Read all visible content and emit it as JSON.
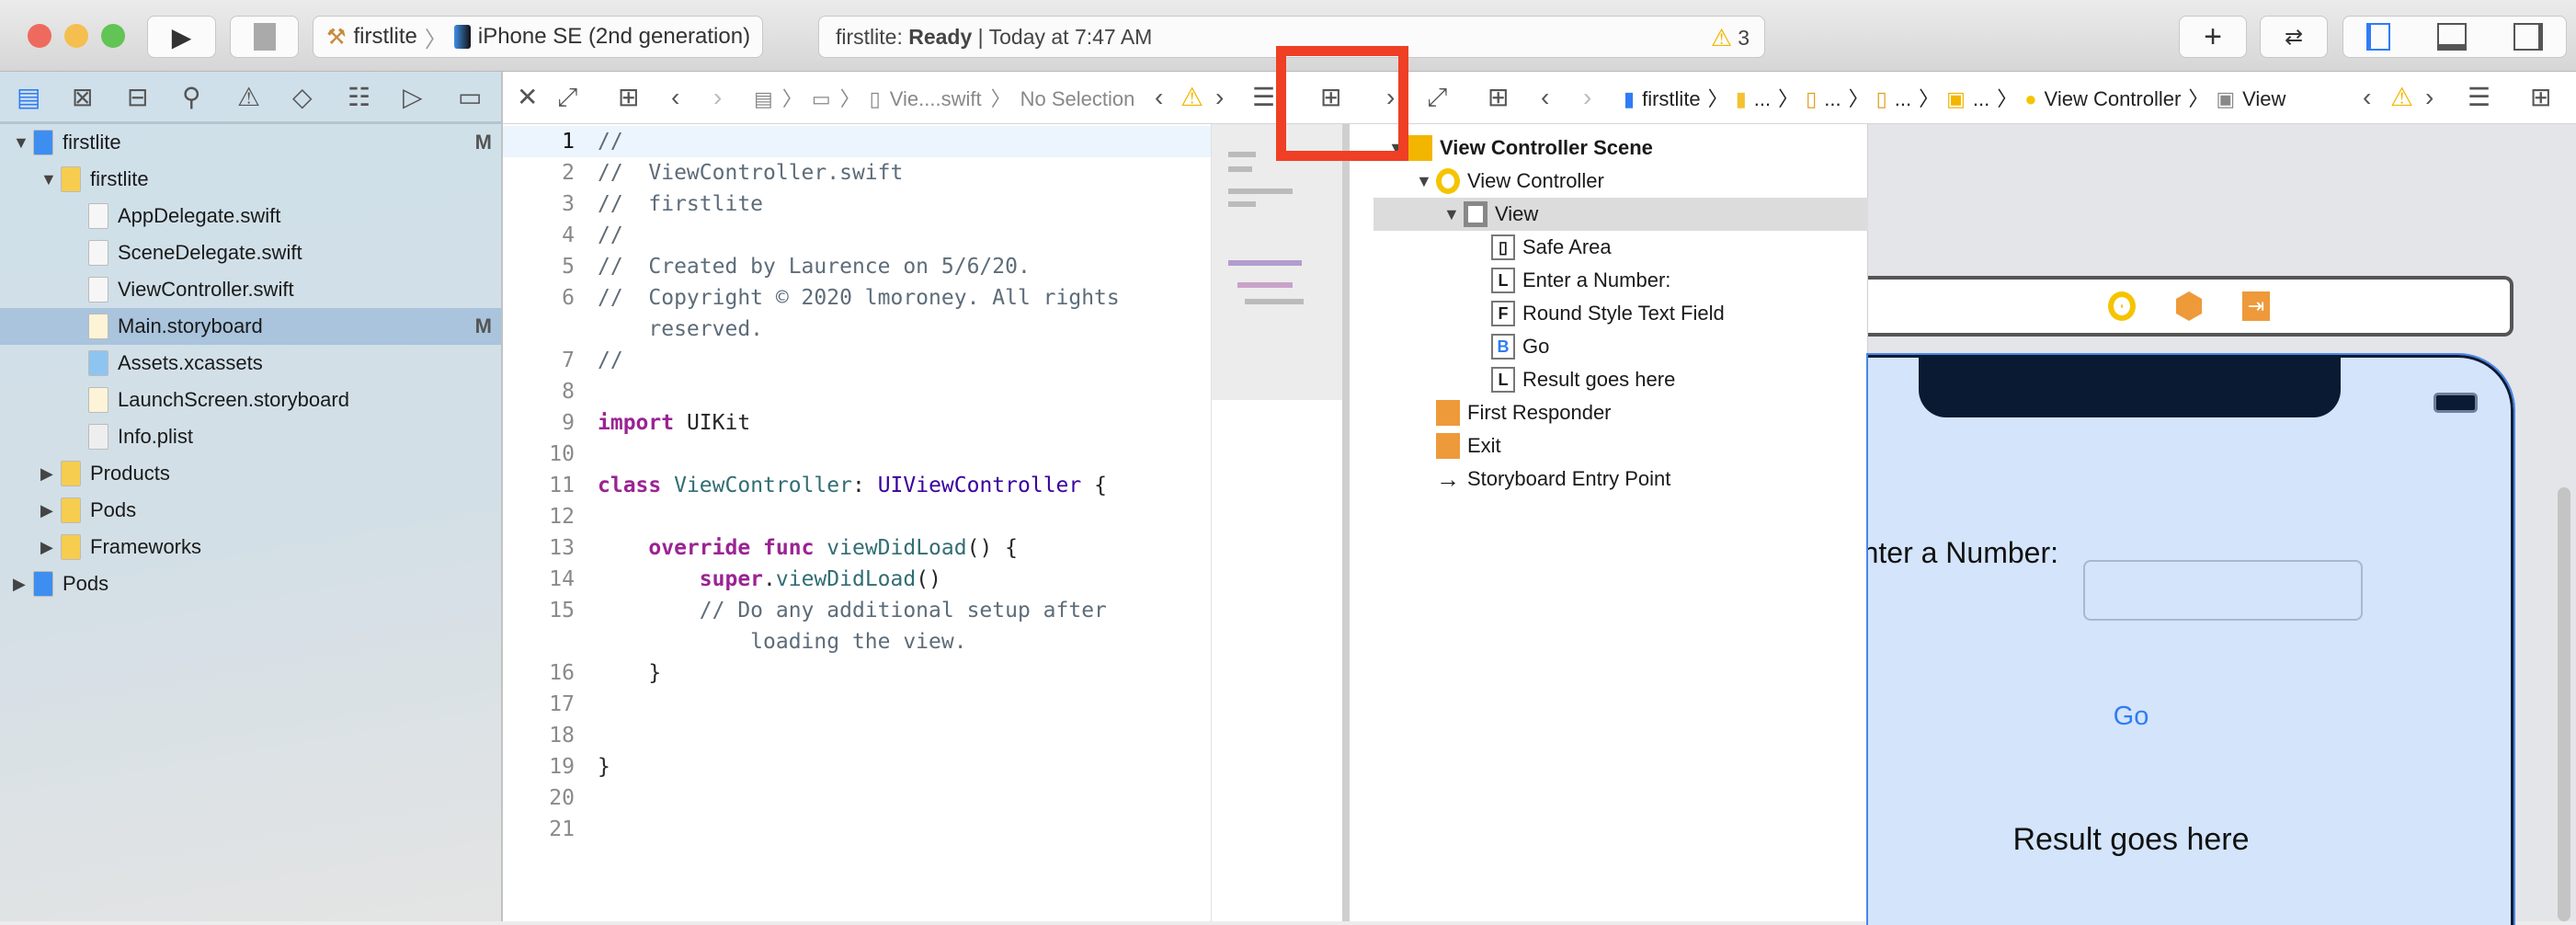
{
  "titlebar": {
    "scheme": "firstlite",
    "device": "iPhone SE (2nd generation)",
    "status_prefix": "firstlite: ",
    "status_bold": "Ready",
    "status_suffix": " | Today at 7:47 AM",
    "warning_count": "3"
  },
  "editor_jump": {
    "file": "Vie....swift",
    "selection": "No Selection"
  },
  "canvas_jump": {
    "project": "firstlite",
    "ellipsis": "...",
    "vc": "View Controller",
    "view": "View"
  },
  "navigator": [
    {
      "label": "firstlite",
      "badge": "M",
      "indent": 0,
      "tri": "▼",
      "icon": "project-icon"
    },
    {
      "label": "firstlite",
      "badge": "",
      "indent": 1,
      "tri": "▼",
      "icon": "folder-icon"
    },
    {
      "label": "AppDelegate.swift",
      "badge": "",
      "indent": 2,
      "tri": "",
      "icon": "swift-file-icon"
    },
    {
      "label": "SceneDelegate.swift",
      "badge": "",
      "indent": 2,
      "tri": "",
      "icon": "swift-file-icon"
    },
    {
      "label": "ViewController.swift",
      "badge": "",
      "indent": 2,
      "tri": "",
      "icon": "swift-file-icon"
    },
    {
      "label": "Main.storyboard",
      "badge": "M",
      "indent": 2,
      "tri": "",
      "icon": "storyboard-file-icon",
      "selected": true
    },
    {
      "label": "Assets.xcassets",
      "badge": "",
      "indent": 2,
      "tri": "",
      "icon": "assets-icon"
    },
    {
      "label": "LaunchScreen.storyboard",
      "badge": "",
      "indent": 2,
      "tri": "",
      "icon": "storyboard-file-icon"
    },
    {
      "label": "Info.plist",
      "badge": "",
      "indent": 2,
      "tri": "",
      "icon": "plist-file-icon"
    },
    {
      "label": "Products",
      "badge": "",
      "indent": 1,
      "tri": "▶",
      "icon": "folder-icon"
    },
    {
      "label": "Pods",
      "badge": "",
      "indent": 1,
      "tri": "▶",
      "icon": "folder-icon"
    },
    {
      "label": "Frameworks",
      "badge": "",
      "indent": 1,
      "tri": "▶",
      "icon": "folder-icon"
    },
    {
      "label": "Pods",
      "badge": "",
      "indent": 0,
      "tri": "▶",
      "icon": "project-icon"
    }
  ],
  "code": [
    {
      "n": "1",
      "t": [
        [
          "//",
          "cm"
        ]
      ]
    },
    {
      "n": "2",
      "t": [
        [
          "//  ViewController.swift",
          "cm"
        ]
      ]
    },
    {
      "n": "3",
      "t": [
        [
          "//  firstlite",
          "cm"
        ]
      ]
    },
    {
      "n": "4",
      "t": [
        [
          "//",
          "cm"
        ]
      ]
    },
    {
      "n": "5",
      "t": [
        [
          "//  Created by Laurence on 5/6/20.",
          "cm"
        ]
      ]
    },
    {
      "n": "6",
      "t": [
        [
          "//  Copyright © 2020 lmoroney. All rights",
          "cm"
        ]
      ]
    },
    {
      "n": "",
      "t": [
        [
          "    reserved.",
          "cm"
        ]
      ]
    },
    {
      "n": "7",
      "t": [
        [
          "//",
          "cm"
        ]
      ]
    },
    {
      "n": "8",
      "t": []
    },
    {
      "n": "9",
      "t": [
        [
          "import",
          "kw"
        ],
        [
          " UIKit",
          "pl"
        ]
      ]
    },
    {
      "n": "10",
      "t": []
    },
    {
      "n": "11",
      "t": [
        [
          "class",
          "kw"
        ],
        [
          " ",
          "pl"
        ],
        [
          "ViewController",
          "fn"
        ],
        [
          ": ",
          "pl"
        ],
        [
          "UIViewController",
          "ty"
        ],
        [
          " {",
          "pl"
        ]
      ]
    },
    {
      "n": "12",
      "t": []
    },
    {
      "n": "13",
      "t": [
        [
          "    ",
          "pl"
        ],
        [
          "override",
          "kw"
        ],
        [
          " ",
          "pl"
        ],
        [
          "func",
          "kw"
        ],
        [
          " ",
          "pl"
        ],
        [
          "viewDidLoad",
          "fn"
        ],
        [
          "() {",
          "pl"
        ]
      ]
    },
    {
      "n": "14",
      "t": [
        [
          "        ",
          "pl"
        ],
        [
          "super",
          "kw"
        ],
        [
          ".",
          "pl"
        ],
        [
          "viewDidLoad",
          "fn"
        ],
        [
          "()",
          "pl"
        ]
      ]
    },
    {
      "n": "15",
      "t": [
        [
          "        // Do any additional setup after",
          "cm"
        ]
      ]
    },
    {
      "n": "",
      "t": [
        [
          "            loading the view.",
          "cm"
        ]
      ]
    },
    {
      "n": "16",
      "t": [
        [
          "    }",
          "pl"
        ]
      ]
    },
    {
      "n": "17",
      "t": []
    },
    {
      "n": "18",
      "t": []
    },
    {
      "n": "19",
      "t": [
        [
          "}",
          "pl"
        ]
      ]
    },
    {
      "n": "20",
      "t": []
    },
    {
      "n": "21",
      "t": []
    }
  ],
  "outline": [
    {
      "label": "View Controller Scene",
      "indent": 0,
      "tri": "▼",
      "icon": "scene-icon",
      "glyph": "",
      "bold": true
    },
    {
      "label": "View Controller",
      "indent": 1,
      "tri": "▼",
      "icon": "view-controller-icon",
      "glyph": ""
    },
    {
      "label": "View",
      "indent": 2,
      "tri": "▼",
      "icon": "view-icon",
      "glyph": "",
      "selected": true
    },
    {
      "label": "Safe Area",
      "indent": 3,
      "tri": "",
      "icon": "safe-area-icon",
      "glyph": "▯"
    },
    {
      "label": "Enter a Number:",
      "indent": 3,
      "tri": "",
      "icon": "label-icon",
      "glyph": "L"
    },
    {
      "label": "Round Style Text Field",
      "indent": 3,
      "tri": "",
      "icon": "text-field-icon",
      "glyph": "F"
    },
    {
      "label": "Go",
      "indent": 3,
      "tri": "",
      "icon": "button-icon",
      "glyph": "B"
    },
    {
      "label": "Result goes here",
      "indent": 3,
      "tri": "",
      "icon": "label-icon",
      "glyph": "L"
    },
    {
      "label": "First Responder",
      "indent": 1,
      "tri": "",
      "icon": "first-responder-icon",
      "glyph": ""
    },
    {
      "label": "Exit",
      "indent": 1,
      "tri": "",
      "icon": "exit-icon",
      "glyph": ""
    },
    {
      "label": "Storyboard Entry Point",
      "indent": 1,
      "tri": "",
      "icon": "entry-arrow-icon",
      "glyph": "→"
    }
  ],
  "canvas": {
    "label_enter": "Enter a Number:",
    "button_go": "Go",
    "label_result": "Result goes here"
  },
  "colors": {
    "accent": "#2f7cf6",
    "highlight": "#ef3f24",
    "selection": "#a9c4dc",
    "phone_bg": "#d4e4fb"
  }
}
